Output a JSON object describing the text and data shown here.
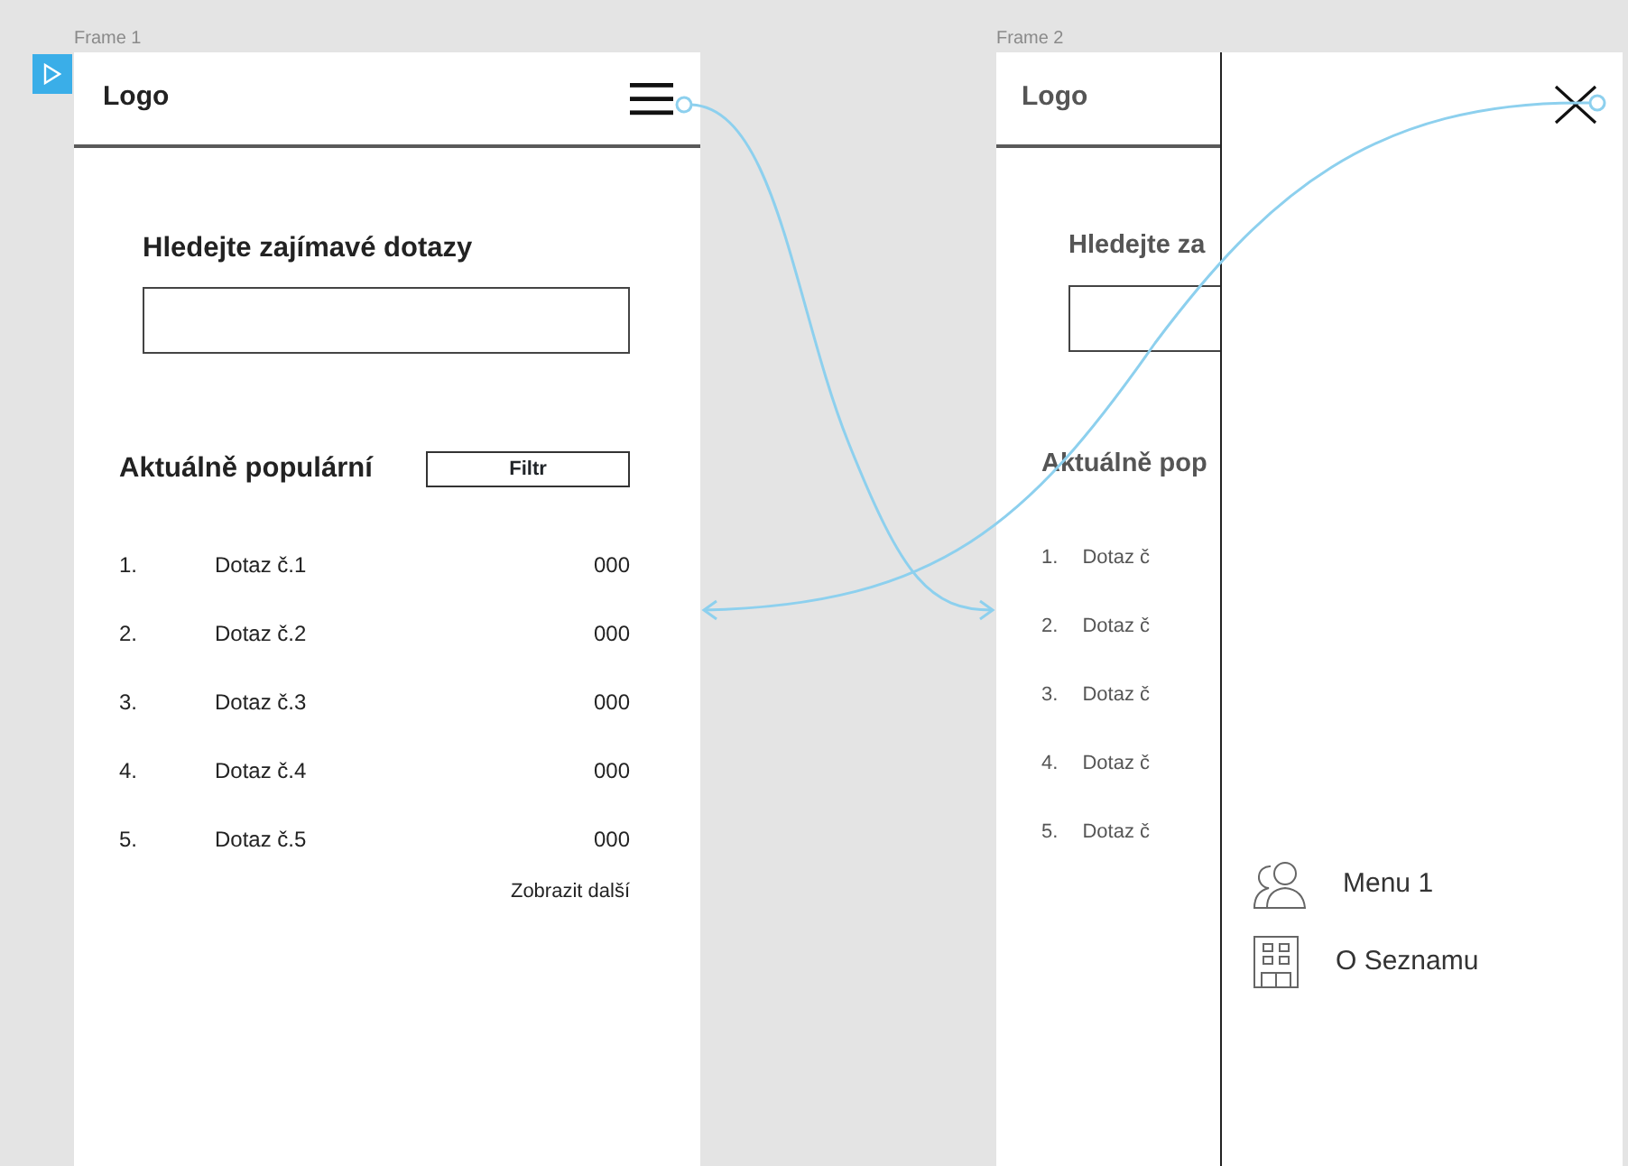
{
  "frames": [
    {
      "label": "Frame 1",
      "header": {
        "logo": "Logo"
      },
      "search": {
        "heading": "Hledejte zajímavé dotazy"
      },
      "popular": {
        "heading": "Aktuálně populární",
        "filter_button": "Filtr",
        "rows": [
          {
            "rank": "1.",
            "query": "Dotaz č.1",
            "count": "000"
          },
          {
            "rank": "2.",
            "query": "Dotaz č.2",
            "count": "000"
          },
          {
            "rank": "3.",
            "query": "Dotaz č.3",
            "count": "000"
          },
          {
            "rank": "4.",
            "query": "Dotaz č.4",
            "count": "000"
          },
          {
            "rank": "5.",
            "query": "Dotaz č.5",
            "count": "000"
          }
        ],
        "more_link": "Zobrazit další"
      }
    },
    {
      "label": "Frame 2",
      "background": {
        "logo": "Logo",
        "search_heading": "Hledejte za",
        "popular_heading": "Aktuálně pop",
        "rows": [
          {
            "rank": "1.",
            "query": "Dotaz č"
          },
          {
            "rank": "2.",
            "query": "Dotaz č"
          },
          {
            "rank": "3.",
            "query": "Dotaz č"
          },
          {
            "rank": "4.",
            "query": "Dotaz č"
          },
          {
            "rank": "5.",
            "query": "Dotaz č"
          }
        ]
      },
      "drawer": {
        "items": [
          {
            "kind": "people",
            "label": "Menu 1"
          },
          {
            "kind": "building",
            "label": "O Seznamu"
          }
        ]
      }
    }
  ]
}
